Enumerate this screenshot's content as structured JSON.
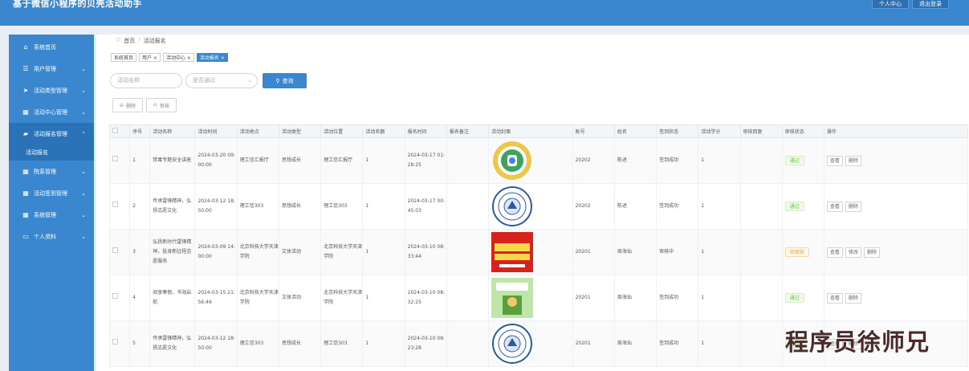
{
  "header": {
    "title": "基于微信小程序的贝壳活动助手",
    "btn_center": "个人中心",
    "btn_logout": "退出登录"
  },
  "sidebar": {
    "items": [
      {
        "label": "系统首页",
        "icon": "home-icon",
        "glyph": "⌂",
        "chev": ""
      },
      {
        "label": "用户管理",
        "icon": "list-icon",
        "glyph": "☰",
        "chev": "⌄"
      },
      {
        "label": "活动类型管理",
        "icon": "send-icon",
        "glyph": "➤",
        "chev": "⌄"
      },
      {
        "label": "活动中心管理",
        "icon": "grid-icon",
        "glyph": "▦",
        "chev": "⌄"
      },
      {
        "label": "活动报名管理",
        "icon": "chat-icon",
        "glyph": "▰",
        "chev": "⌃"
      },
      {
        "label": "院系管理",
        "icon": "grid-icon",
        "glyph": "▦",
        "chev": "⌄"
      },
      {
        "label": "活动签到管理",
        "icon": "grid-icon",
        "glyph": "▦",
        "chev": "⌄"
      },
      {
        "label": "系统管理",
        "icon": "grid-icon",
        "glyph": "▦",
        "chev": "⌄"
      },
      {
        "label": "个人资料",
        "icon": "card-icon",
        "glyph": "▭",
        "chev": "⌄"
      }
    ],
    "sub_item": "活动报名"
  },
  "breadcrumb": {
    "home": "首页",
    "sep": "/",
    "current": "活动报名"
  },
  "tabs": [
    "系统首页",
    "用户 ×",
    "活动中心 ×",
    "活动报名 ×"
  ],
  "search": {
    "name_placeholder": "活动名称",
    "status_placeholder": "是否通过",
    "query_label": "查询"
  },
  "actions": {
    "delete_label": "删除",
    "review_label": "审核"
  },
  "table": {
    "columns": [
      "",
      "序号",
      "活动名称",
      "活动时间",
      "活动地点",
      "活动类型",
      "活动位置",
      "活动名额",
      "报名时间",
      "报名备注",
      "活动封面",
      "账号",
      "姓名",
      "签到状态",
      "活动学分",
      "审核回复",
      "审核状态",
      "操作"
    ],
    "rows": [
      {
        "no": "1",
        "name": "禁毒专题安全讲座",
        "time": "2024-03-20 09:00:00",
        "place": "理工信汇报厅",
        "type": "思想成长",
        "loc": "理工信汇报厅",
        "quota": "1",
        "signup": "2024-03-17 01:28:25",
        "remark": "",
        "cover": "cover-badge",
        "account": "20202",
        "uname": "陈述",
        "checkin": "签到成功",
        "credit": "1",
        "reply": "",
        "status": "通过",
        "ops": [
          "查看",
          "删除"
        ]
      },
      {
        "no": "2",
        "name": "传承雷锋精神，弘扬志愿文化",
        "time": "2024-03-12 18:50:00",
        "place": "理工信303",
        "type": "思想成长",
        "loc": "理工信303",
        "quota": "1",
        "signup": "2024-03-17 00:45:03",
        "remark": "",
        "cover": "cover-seal",
        "account": "20202",
        "uname": "陈述",
        "checkin": "签到成功",
        "credit": "1",
        "reply": "",
        "status": "通过",
        "ops": [
          "查看",
          "删除"
        ]
      },
      {
        "no": "3",
        "name": "弘扬新时代雷锋精神，投身新征程志愿服务",
        "time": "2024-03-09 14:00:00",
        "place": "北京科技大学天津学院",
        "type": "文体活动",
        "loc": "北京科技大学天津学院",
        "quota": "1",
        "signup": "2024-03-10 08:33:44",
        "remark": "",
        "cover": "cover-poster",
        "account": "20201",
        "uname": "周海仙",
        "checkin": "审核中",
        "credit": "1",
        "reply": "",
        "status": "待审核",
        "ops": [
          "查看",
          "修改",
          "删除"
        ]
      },
      {
        "no": "4",
        "name": "阅享寒假，书海启航",
        "time": "2024-03-15 21:56:46",
        "place": "北京科技大学天津学院",
        "type": "文体活动",
        "loc": "北京科技大学天津学院",
        "quota": "1",
        "signup": "2024-03-10 08:32:25",
        "remark": "",
        "cover": "cover-book",
        "account": "20201",
        "uname": "周海仙",
        "checkin": "签到成功",
        "credit": "1",
        "reply": "",
        "status": "通过",
        "ops": [
          "查看",
          "删除"
        ]
      },
      {
        "no": "5",
        "name": "传承雷锋精神，弘扬志愿文化",
        "time": "2024-03-12 18:50:00",
        "place": "理工信303",
        "type": "思想成长",
        "loc": "理工信303",
        "quota": "1",
        "signup": "2024-03-10 08:23:28",
        "remark": "",
        "cover": "cover-seal",
        "account": "20201",
        "uname": "周海仙",
        "checkin": "签到成功",
        "credit": "1",
        "reply": "",
        "status": "通过",
        "ops": [
          "查看",
          "删除"
        ]
      }
    ]
  },
  "watermark": "程序员徐师兄",
  "colors": {
    "primary": "#3a86cf",
    "pass_bg": "#f0f9eb",
    "pass_fg": "#67c23a",
    "pending_bg": "#fdf6ec",
    "pending_fg": "#e6a23c"
  }
}
